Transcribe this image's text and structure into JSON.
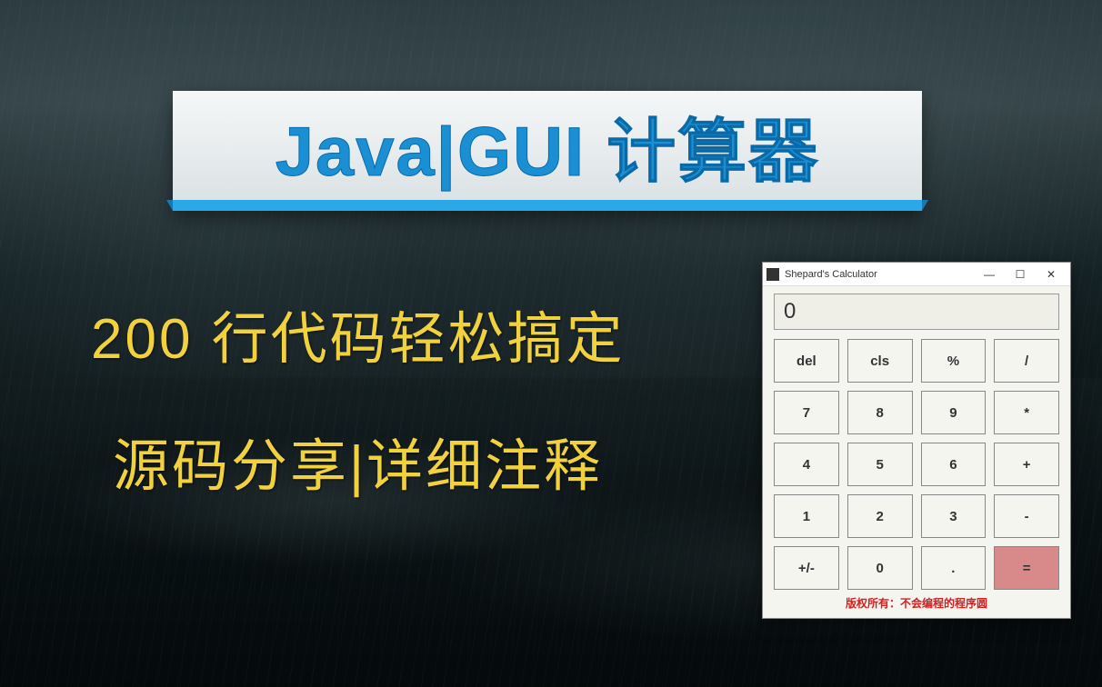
{
  "banner": {
    "title": "Java|GUI 计算器"
  },
  "subtitle1": "200 行代码轻松搞定",
  "subtitle2": "源码分享|详细注释",
  "calculator": {
    "window_title": "Shepard's Calculator",
    "display_value": "0",
    "buttons": {
      "del": "del",
      "cls": "cls",
      "percent": "%",
      "divide": "/",
      "seven": "7",
      "eight": "8",
      "nine": "9",
      "multiply": "*",
      "four": "4",
      "five": "5",
      "six": "6",
      "plus": "+",
      "one": "1",
      "two": "2",
      "three": "3",
      "minus": "-",
      "plusminus": "+/-",
      "zero": "0",
      "dot": ".",
      "equals": "="
    },
    "footer": "版权所有：不会编程的程序圆",
    "winctl": {
      "min": "—",
      "max": "☐",
      "close": "✕"
    }
  }
}
